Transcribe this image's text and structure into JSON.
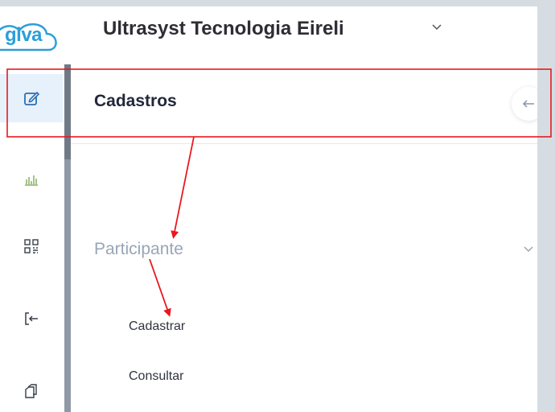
{
  "header": {
    "logo_text": "giva",
    "company_name": "Ultrasyst Tecnologia Eireli"
  },
  "rail": {
    "icons": [
      "edit-icon",
      "bar-chart-icon",
      "qr-code-icon",
      "sign-in-icon",
      "copy-documents-icon"
    ]
  },
  "panel": {
    "title": "Cadastros",
    "section": {
      "label": "Participante",
      "items": [
        {
          "label": "Cadastrar"
        },
        {
          "label": "Consultar"
        }
      ]
    }
  },
  "colors": {
    "accent": "#2b9fd8",
    "annotation": "#e8181f",
    "active_rail_bg": "#e6f1fb"
  }
}
